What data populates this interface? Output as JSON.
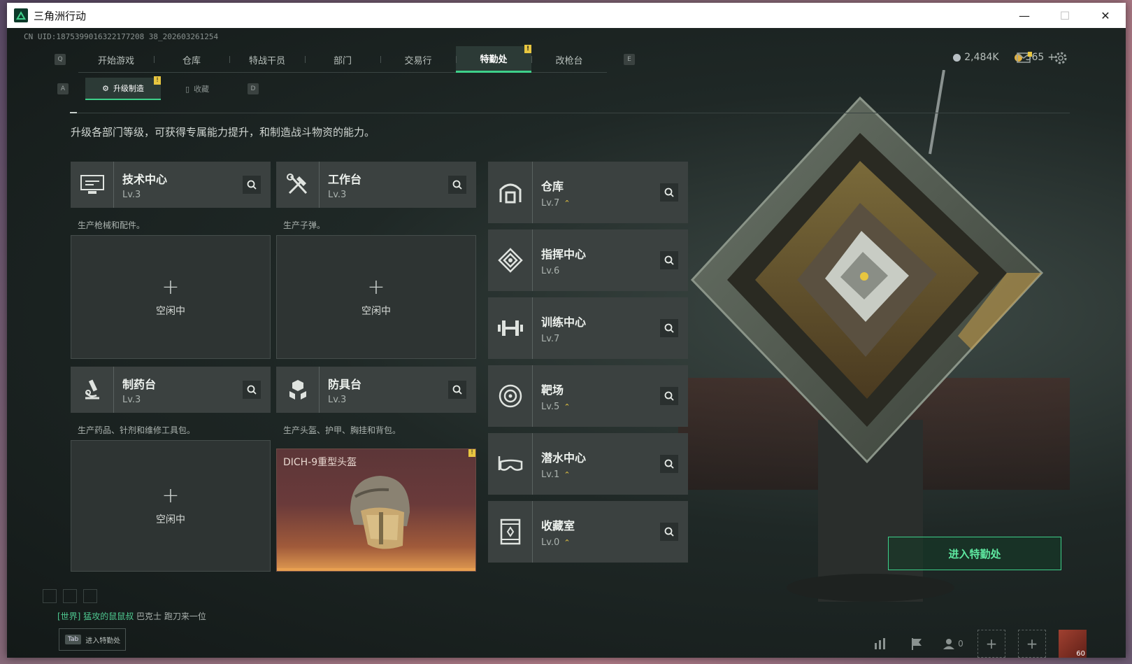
{
  "window": {
    "title": "三角洲行动",
    "controls": [
      "minimize",
      "maximize",
      "close"
    ]
  },
  "uid": "CN UID:1875399016322177208 38_202603261254",
  "top_nav": {
    "left_key": "Q",
    "right_key": "E",
    "tabs": [
      {
        "label": "开始游戏",
        "active": false
      },
      {
        "label": "仓库",
        "active": false
      },
      {
        "label": "特战干员",
        "active": false
      },
      {
        "label": "部门",
        "active": false
      },
      {
        "label": "交易行",
        "active": false
      },
      {
        "label": "特勤处",
        "active": true,
        "alert": "!"
      },
      {
        "label": "改枪台",
        "active": false
      }
    ]
  },
  "currency": {
    "silver": "2,484K",
    "gold": "365",
    "gold_add": "+"
  },
  "sub_nav": {
    "left_key": "A",
    "right_key": "D",
    "tabs": [
      {
        "label": "升级制造",
        "active": true,
        "alert": "!"
      },
      {
        "label": "收藏",
        "active": false
      }
    ]
  },
  "description": "升级各部门等级，可获得专属能力提升，和制造战斗物资的能力。",
  "workbenches": [
    {
      "name": "技术中心",
      "level": "Lv.3",
      "desc": "生产枪械和配件。",
      "status_plus": "+",
      "status": "空闲中",
      "icon": "computer-icon"
    },
    {
      "name": "工作台",
      "level": "Lv.3",
      "desc": "生产子弹。",
      "status_plus": "+",
      "status": "空闲中",
      "icon": "tools-icon"
    },
    {
      "name": "制药台",
      "level": "Lv.3",
      "desc": "生产药品、针剂和维修工具包。",
      "status_plus": "+",
      "status": "空闲中",
      "icon": "microscope-icon"
    },
    {
      "name": "防具台",
      "level": "Lv.3",
      "desc": "生产头盔、护甲、胸挂和背包。",
      "item": "DICH-9重型头盔",
      "alert": "!",
      "icon": "armor-icon"
    }
  ],
  "departments": [
    {
      "name": "仓库",
      "level": "Lv.7",
      "upgradable": true,
      "icon": "warehouse-icon"
    },
    {
      "name": "指挥中心",
      "level": "Lv.6",
      "upgradable": false,
      "icon": "command-icon"
    },
    {
      "name": "训练中心",
      "level": "Lv.7",
      "upgradable": false,
      "icon": "dumbbell-icon"
    },
    {
      "name": "靶场",
      "level": "Lv.5",
      "upgradable": true,
      "icon": "target-icon"
    },
    {
      "name": "潜水中心",
      "level": "Lv.1",
      "upgradable": true,
      "icon": "goggles-icon"
    },
    {
      "name": "收藏室",
      "level": "Lv.0",
      "upgradable": true,
      "icon": "collection-icon"
    }
  ],
  "upgrade_glyph": "⌃",
  "enter_button": "进入特勤处",
  "chat": {
    "channel": "[世界]",
    "user": "猛攻的鼠鼠叔",
    "message": "巴克士  跑刀来一位"
  },
  "tab_hint": {
    "key": "Tab",
    "label": "进入特勤处"
  },
  "bottom": {
    "friends_count": "0",
    "player_level": "60"
  },
  "colors": {
    "accent": "#3ed08a",
    "alert": "#e8c640",
    "panel": "#3b4140"
  }
}
